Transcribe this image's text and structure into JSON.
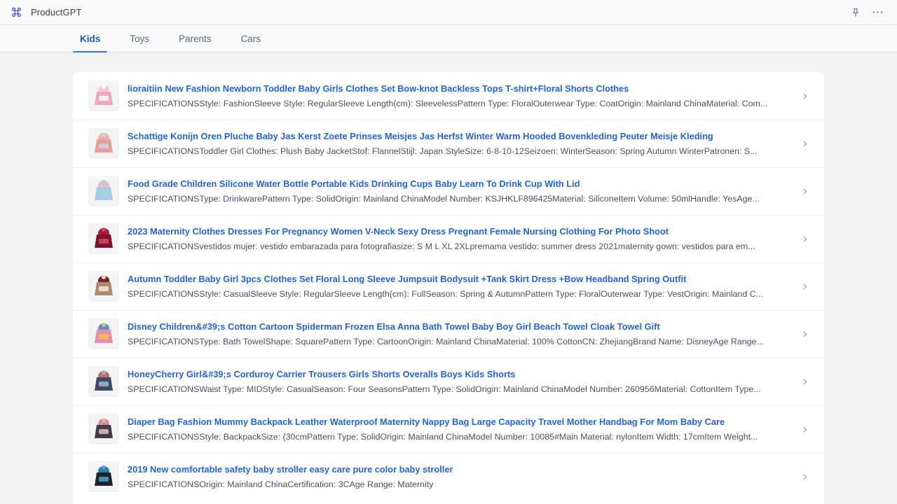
{
  "appbar": {
    "title": "ProductGPT",
    "logo_icon": "clover-grid-icon",
    "pin_icon": "pin-icon",
    "more_icon": "more-horizontal-icon"
  },
  "tabs": [
    {
      "label": "Kids",
      "active": true
    },
    {
      "label": "Toys",
      "active": false
    },
    {
      "label": "Parents",
      "active": false
    },
    {
      "label": "Cars",
      "active": false
    }
  ],
  "results": [
    {
      "title": "lioraitiin New Fashion Newborn Toddler Baby Girls Clothes Set Bow-knot Backless Tops T-shirt+Floral Shorts Clothes",
      "spec": "SPECIFICATIONSStyle: FashionSleeve Style: RegularSleeve Length(cm): SleevelessPattern Type: FloralOuterwear Type: CoatOrigin: Mainland ChinaMaterial: Com...",
      "thumb_name": "product-thumbnail-baby-girl-outfit",
      "thumb_colors": [
        "#f6c9d4",
        "#efa8bc",
        "#ffffff"
      ]
    },
    {
      "title": "Schattige Konijn Oren Pluche Baby Jas Kerst Zoete Prinses Meisjes Jas Herfst Winter Warm Hooded Bovenkleding Peuter Meisje Kleding",
      "spec": "SPECIFICATIONSToddler Girl Clothes: Plush Baby JacketStof: FlannelStijl: Japan StyleSize: 6-8-10-12Seizoen: WinterSeason: Spring Autumn WinterPatronen: S...",
      "thumb_name": "product-thumbnail-pink-plush-jacket",
      "thumb_colors": [
        "#f2b3ac",
        "#e89f98",
        "#c9d2e2"
      ]
    },
    {
      "title": "Food Grade Children Silicone Water Bottle Portable Kids Drinking Cups Baby Learn To Drink Cup With Lid",
      "spec": "SPECIFICATIONSType: DrinkwarePattern Type: SolidOrigin: Mainland ChinaModel Number: KSJHKLF896425Material: SiliconeItem Volume: 50mlHandle: YesAge...",
      "thumb_name": "product-thumbnail-silicone-cups",
      "thumb_colors": [
        "#f3b7c9",
        "#a9c9e8",
        "#9fd8cf"
      ]
    },
    {
      "title": "2023 Maternity Clothes Dresses For Pregnancy Women V-Neck Sexy Dress Pregnant Female Nursing Clothing For Photo Shoot",
      "spec": "SPECIFICATIONSvestidos mujer: vestido embarazada para fotografiasize: S M L XL 2XLpremama vestido: summer dress 2021maternity gown: vestidos para em...",
      "thumb_name": "product-thumbnail-maternity-dress",
      "thumb_colors": [
        "#a8193a",
        "#7f1230",
        "#d14a63"
      ]
    },
    {
      "title": "Autumn Toddler Baby Girl 3pcs Clothes Set Floral Long Sleeve Jumpsuit Bodysuit +Tank Skirt Dress +Bow Headband Spring Outfit",
      "spec": "SPECIFICATIONSStyle: CasualSleeve Style: RegularSleeve Length(cm): FullSeason: Spring & AutumnPattern Type: FloralOuterwear Type: VestOrigin: Mainland C...",
      "thumb_name": "product-thumbnail-toddler-3pcs-set",
      "thumb_colors": [
        "#6d2430",
        "#b08a6a",
        "#f0e6d8"
      ]
    },
    {
      "title": "Disney Children&#39;s Cotton Cartoon Spiderman Frozen Elsa Anna Bath Towel Baby Boy Girl Beach Towel Cloak Towel Gift",
      "spec": "SPECIFICATIONSType: Bath TowelShape: SquarePattern Type: CartoonOrigin: Mainland ChinaMaterial: 100% CottonCN: ZhejiangBrand Name: DisneyAge Range...",
      "thumb_name": "product-thumbnail-cartoon-bath-towels",
      "thumb_colors": [
        "#5a8fd6",
        "#e58db0",
        "#f2c24a"
      ]
    },
    {
      "title": "HoneyCherry Girl&#39;s Corduroy Carrier Trousers Girls Shorts Overalls Boys Kids Shorts",
      "spec": "SPECIFICATIONSWaist Type: MIDStyle: CasualSeason: Four SeasonsPattern Type: SolidOrigin: Mainland ChinaModel Number: 260956Material: CottonItem Type...",
      "thumb_name": "product-thumbnail-corduroy-overalls",
      "thumb_colors": [
        "#c56e6e",
        "#3c4a63",
        "#9fb8cf"
      ]
    },
    {
      "title": "Diaper Bag Fashion Mummy Backpack Leather Waterproof Maternity Nappy Bag Large Capacity Travel Mother Handbag For Mom Baby Care",
      "spec": "SPECIFICATIONSStyle: BackpackSize: (30cmPattern Type: SolidOrigin: Mainland ChinaModel Number: 10085#Main Material: nylonItem Width: 17cmItem Weight...",
      "thumb_name": "product-thumbnail-diaper-backpack",
      "thumb_colors": [
        "#d98f96",
        "#3b3f4a",
        "#e7b7bd"
      ]
    },
    {
      "title": "2019 New comfortable safety baby stroller easy care pure color baby stroller",
      "spec": "SPECIFICATIONSOrigin: Mainland ChinaCertification: 3CAge Range: Maternity",
      "thumb_name": "product-thumbnail-baby-stroller",
      "thumb_colors": [
        "#2b7fa8",
        "#1f2328",
        "#4aa3c9"
      ]
    }
  ],
  "icons": {
    "chevron_right": "chevron-right-icon"
  }
}
